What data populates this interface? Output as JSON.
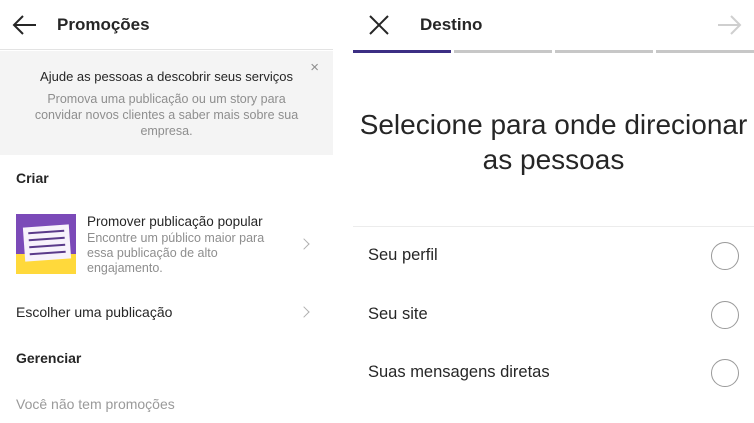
{
  "left": {
    "title": "Promoções",
    "banner": {
      "close": "×",
      "title": "Ajude as pessoas a descobrir seus serviços",
      "text": "Promova uma publicação ou um story para convidar novos clientes a saber mais sobre sua empresa."
    },
    "create_section": "Criar",
    "promote_popular": {
      "title": "Promover publicação popular",
      "desc": "Encontre um público maior para essa publicação de alto engajamento."
    },
    "choose_post": "Escolher uma publicação",
    "manage_section": "Gerenciar",
    "no_promotions": "Você não tem promoções"
  },
  "right": {
    "title": "Destino",
    "steps_total": 4,
    "active_step": 1,
    "headline": "Selecione para onde direcionar as pessoas",
    "options": [
      {
        "label": "Seu perfil",
        "selected": false
      },
      {
        "label": "Seu site",
        "selected": false
      },
      {
        "label": "Suas mensagens diretas",
        "selected": false
      }
    ]
  },
  "colors": {
    "active_step": "#3c2f84",
    "inactive_step": "#c7c7c7",
    "banner_bg": "#f4f4f4",
    "muted_text": "#8e8e8e"
  }
}
